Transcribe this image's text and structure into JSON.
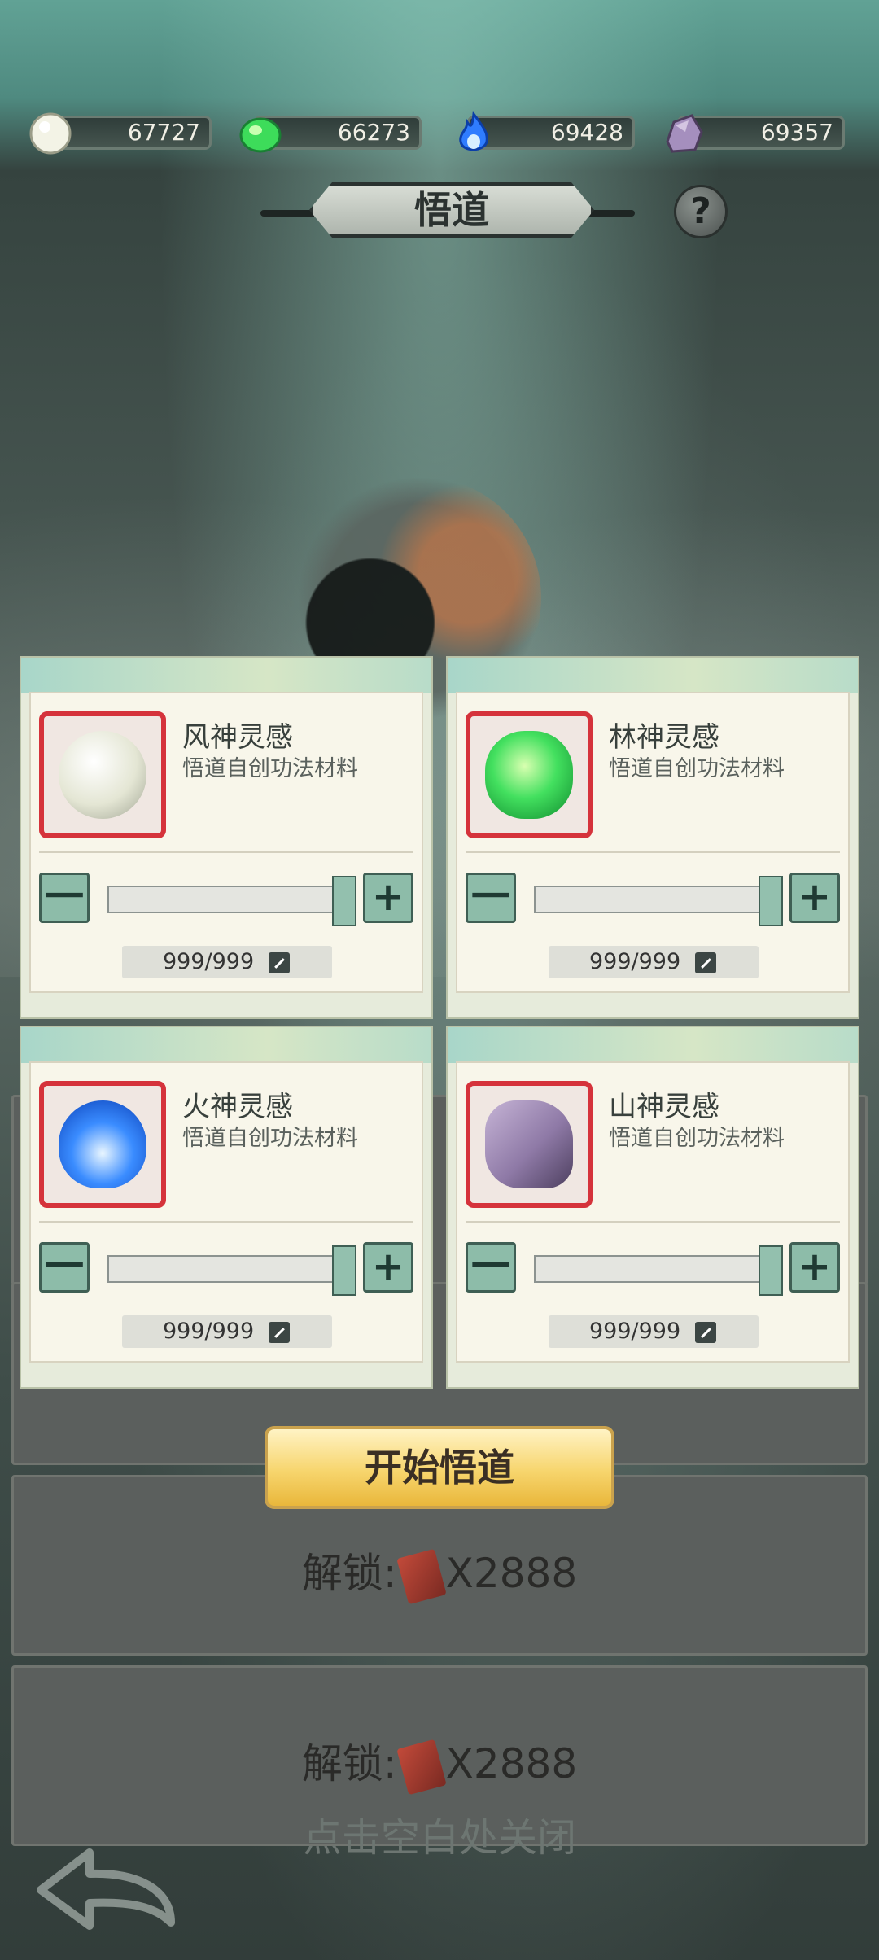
{
  "resources": [
    {
      "icon": "pearl-icon",
      "value": "67727"
    },
    {
      "icon": "green-jade-icon",
      "value": "66273"
    },
    {
      "icon": "blue-flame-icon",
      "value": "69428"
    },
    {
      "icon": "purple-stone-icon",
      "value": "69357"
    }
  ],
  "header": {
    "title": "悟道",
    "help_label": "?"
  },
  "cards": [
    {
      "name": "风神灵感",
      "desc": "悟道自创功法材料",
      "minus": "一",
      "plus": "+",
      "qty": "999/999",
      "icon": "wind-orb-icon"
    },
    {
      "name": "林神灵感",
      "desc": "悟道自创功法材料",
      "minus": "一",
      "plus": "+",
      "qty": "999/999",
      "icon": "forest-orb-icon"
    },
    {
      "name": "火神灵感",
      "desc": "悟道自创功法材料",
      "minus": "一",
      "plus": "+",
      "qty": "999/999",
      "icon": "fire-orb-icon"
    },
    {
      "name": "山神灵感",
      "desc": "悟道自创功法材料",
      "minus": "一",
      "plus": "+",
      "qty": "999/999",
      "icon": "mountain-stone-icon"
    }
  ],
  "start_button": "开始悟道",
  "unlocks": [
    {
      "label": "解锁",
      "sep": ":",
      "cost": "X2888"
    },
    {
      "label": "解锁",
      "sep": ":",
      "cost": "X2888"
    }
  ],
  "close_hint": "点击空白处关闭"
}
